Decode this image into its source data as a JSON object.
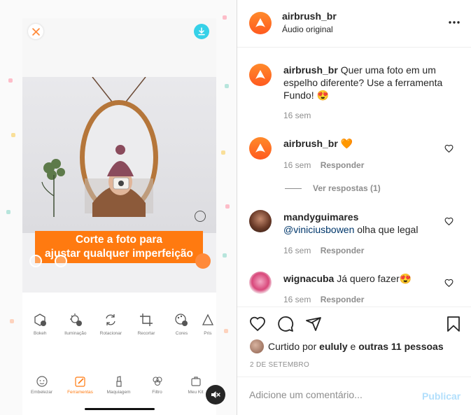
{
  "media": {
    "banner_line1": "Corte a foto para",
    "banner_line2": "ajustar qualquer imperfeição",
    "tools": [
      {
        "label": "Bokeh",
        "icon": "bokeh-icon"
      },
      {
        "label": "Iluminação",
        "icon": "lighting-icon"
      },
      {
        "label": "Rotacionar",
        "icon": "rotate-icon"
      },
      {
        "label": "Recortar",
        "icon": "crop-icon"
      },
      {
        "label": "Cores",
        "icon": "palette-icon"
      },
      {
        "label": "Pris",
        "icon": "prism-icon"
      }
    ],
    "nav": [
      {
        "label": "Embelezar",
        "icon": "face-icon"
      },
      {
        "label": "Ferramentas",
        "icon": "pencil-icon"
      },
      {
        "label": "Maquiagem",
        "icon": "lipstick-icon"
      },
      {
        "label": "Filtro",
        "icon": "filter-icon"
      },
      {
        "label": "Meu Kit",
        "icon": "kit-icon"
      }
    ],
    "active_nav_color": "#ff7a10"
  },
  "post": {
    "username": "airbrush_br",
    "audio": "Áudio original"
  },
  "comments": [
    {
      "username": "airbrush_br",
      "text": "Quer uma foto em um espelho diferente? Use a ferramenta Fundo! 😍",
      "time": "16 sem"
    },
    {
      "username": "airbrush_br",
      "text": "🧡",
      "time": "16 sem",
      "reply_label": "Responder",
      "view_replies": "Ver respostas (1)"
    },
    {
      "username": "mandyguimares",
      "mention": "@viniciusbowen",
      "text": "olha que legal",
      "time": "16 sem",
      "reply_label": "Responder"
    },
    {
      "username": "wignacuba",
      "text": "Já quero fazer😍",
      "time": "16 sem",
      "reply_label": "Responder"
    }
  ],
  "likes": {
    "prefix": "Curtido por",
    "user": "eululy",
    "connector": "e",
    "others": "outras 11 pessoas"
  },
  "date": "2 DE SETEMBRO",
  "add_comment": {
    "placeholder": "Adicione um comentário...",
    "publish_label": "Publicar"
  },
  "colors": {
    "brand": "#ff6b1a",
    "publish_disabled": "#b2dffc",
    "mention": "#00376b",
    "download": "#36d1e8"
  }
}
